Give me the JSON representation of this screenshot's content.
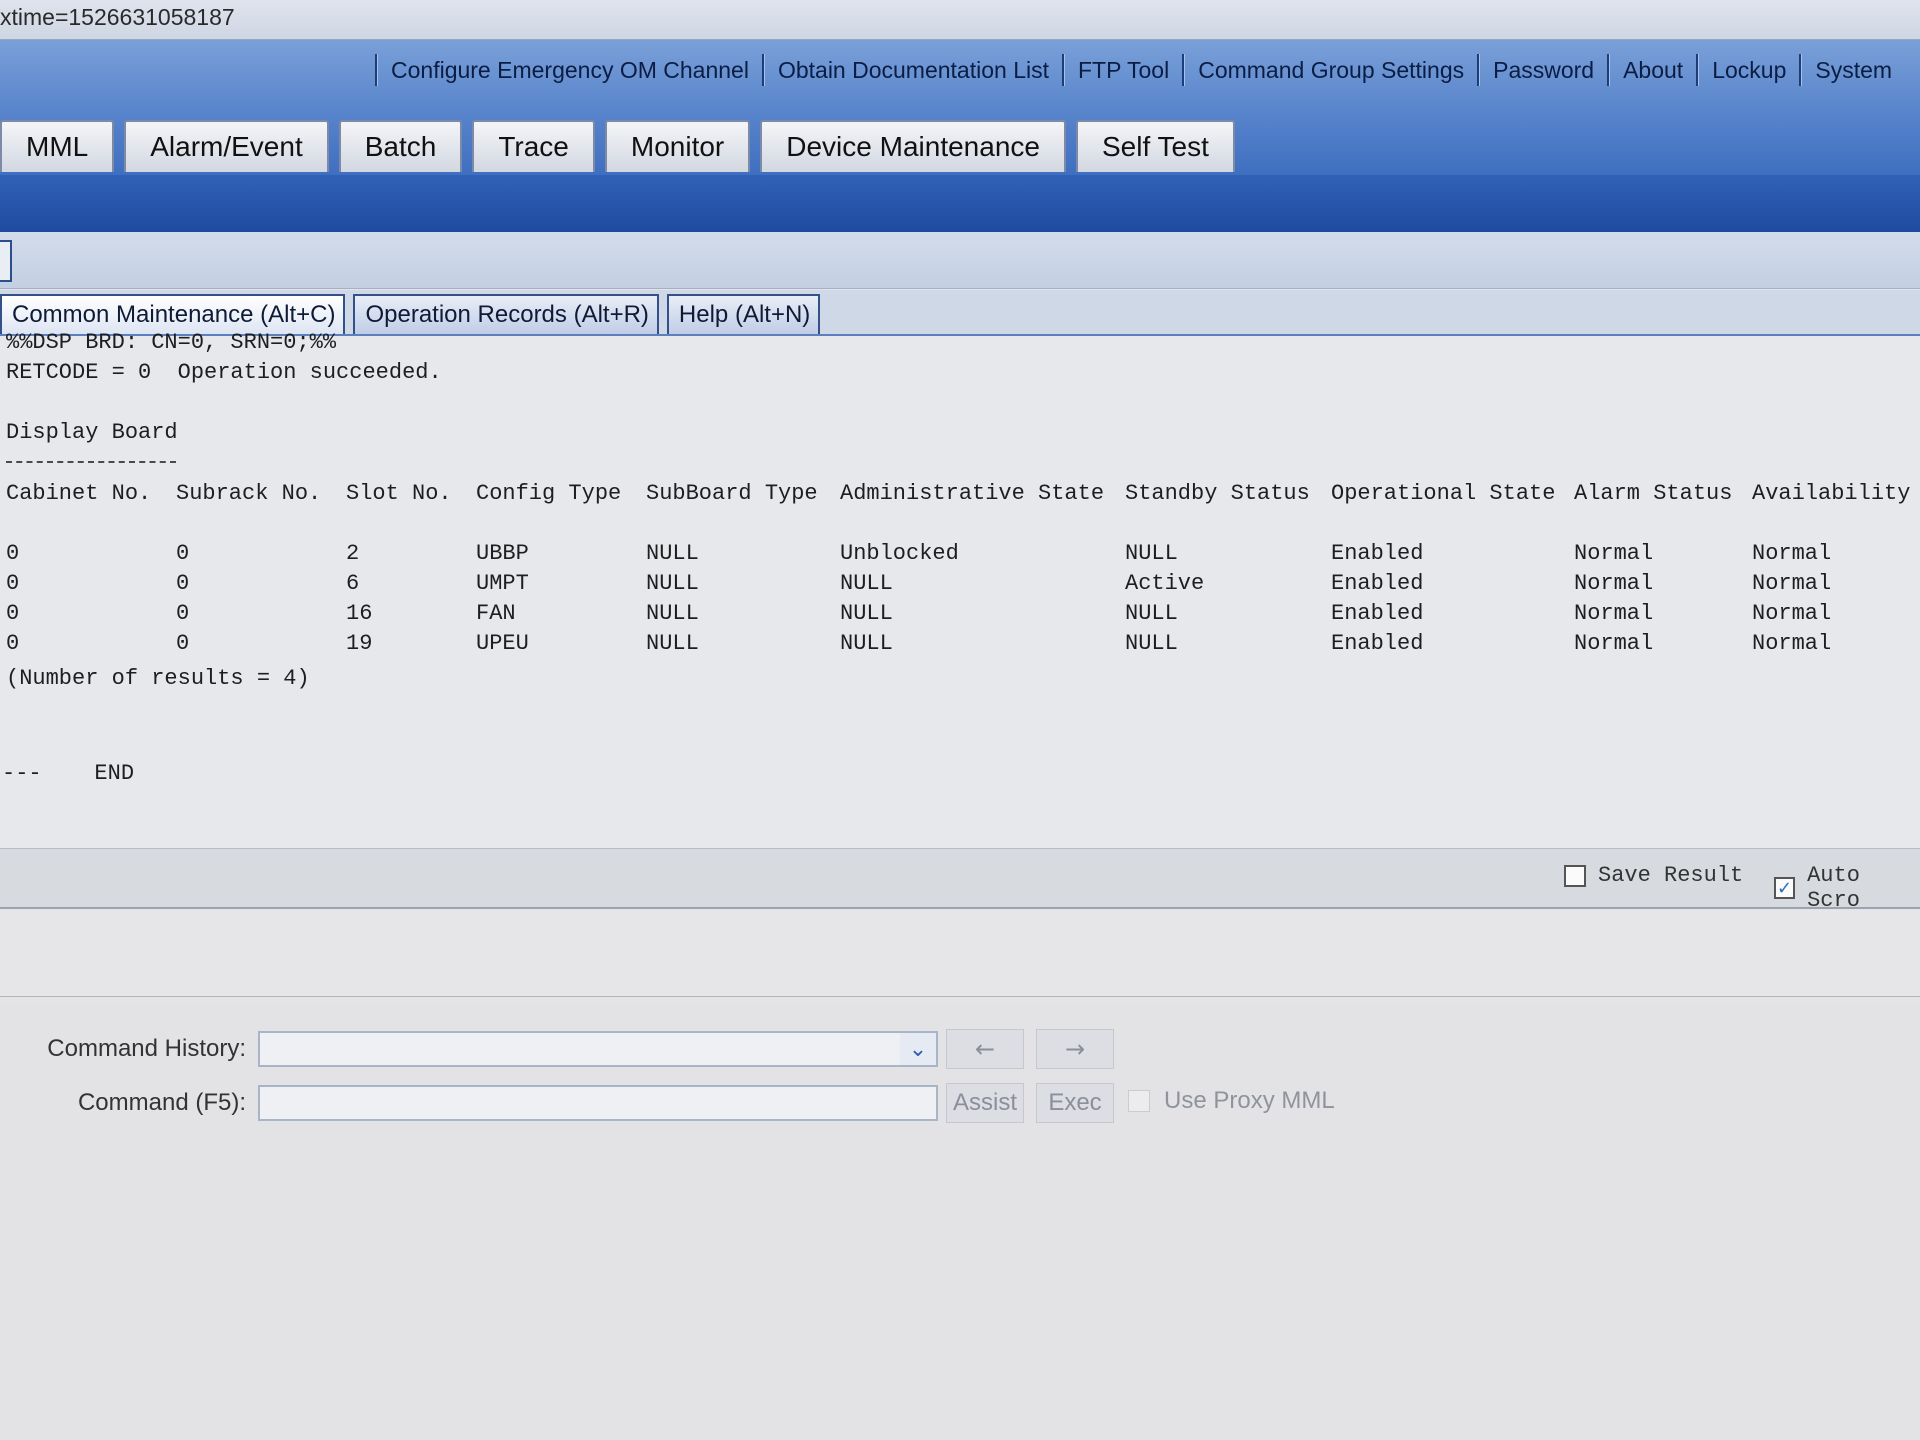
{
  "address_bar": {
    "text": "xtime=1526631058187"
  },
  "top_menu": [
    "Configure Emergency OM Channel",
    "Obtain Documentation List",
    "FTP Tool",
    "Command Group Settings",
    "Password",
    "About",
    "Lockup",
    "System"
  ],
  "main_tabs": [
    "MML",
    "Alarm/Event",
    "Batch",
    "Trace",
    "Monitor",
    "Device Maintenance",
    "Self Test"
  ],
  "sub_tabs": [
    {
      "label": "Common Maintenance (Alt+C)",
      "active": true
    },
    {
      "label": "Operation Records (Alt+R)",
      "active": false
    },
    {
      "label": "Help (Alt+N)",
      "active": false
    }
  ],
  "output": {
    "command_echo": "%%DSP BRD: CN=0, SRN=0;%%",
    "retcode": "RETCODE = 0  Operation succeeded.",
    "section_title": "Display Board",
    "columns": [
      "Cabinet No.",
      "Subrack No.",
      "Slot No.",
      "Config Type",
      "SubBoard Type",
      "Administrative State",
      "Standby Status",
      "Operational State",
      "Alarm Status",
      "Availability"
    ],
    "rows": [
      [
        "0",
        "0",
        "2",
        "UBBP",
        "NULL",
        "Unblocked",
        "NULL",
        "Enabled",
        "Normal",
        "Normal"
      ],
      [
        "0",
        "0",
        "6",
        "UMPT",
        "NULL",
        "NULL",
        "Active",
        "Enabled",
        "Normal",
        "Normal"
      ],
      [
        "0",
        "0",
        "16",
        "FAN",
        "NULL",
        "NULL",
        "NULL",
        "Enabled",
        "Normal",
        "Normal"
      ],
      [
        "0",
        "0",
        "19",
        "UPEU",
        "NULL",
        "NULL",
        "NULL",
        "Enabled",
        "Normal",
        "Normal"
      ]
    ],
    "result_count": "(Number of results = 4)",
    "end_marker": "---    END"
  },
  "options": {
    "save_result": {
      "label": "Save Result",
      "checked": false
    },
    "auto_scroll": {
      "label": "Auto Scro",
      "checked": true
    }
  },
  "command_panel": {
    "history_label": "Command History:",
    "history_value": "",
    "back_button": "←",
    "forward_button": "→",
    "command_label": "Command (F5):",
    "command_value": "",
    "assist_button": "Assist",
    "exec_button": "Exec",
    "proxy_label": "Use Proxy MML",
    "proxy_checked": false
  }
}
